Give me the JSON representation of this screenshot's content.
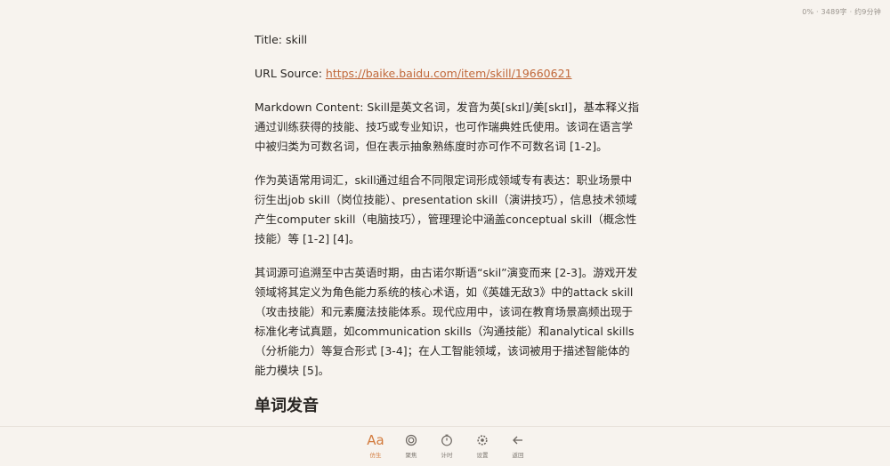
{
  "status_bar": {
    "text": "0% · 3489字 · 约9分钟"
  },
  "article": {
    "title_line": "Title: skill",
    "url_label": "URL Source: ",
    "url": "https://baike.baidu.com/item/skill/19660621",
    "paragraphs": [
      "Markdown Content: Skill是英文名词，发音为英[skɪl]/美[skɪl]，基本释义指通过训练获得的技能、技巧或专业知识，也可作瑞典姓氏使用。该词在语言学中被归类为可数名词，但在表示抽象熟练度时亦可作不可数名词 [1-2]。",
      "作为英语常用词汇，skill通过组合不同限定词形成领域专有表达：职业场景中衍生出job skill（岗位技能）、presentation skill（演讲技巧），信息技术领域产生computer skill（电脑技巧），管理理论中涵盖conceptual skill（概念性技能）等 [1-2] [4]。",
      "其词源可追溯至中古英语时期，由古诺尔斯语“skil”演变而来 [2-3]。游戏开发领域将其定义为角色能力系统的核心术语，如《英雄无敌3》中的attack skill（攻击技能）和元素魔法技能体系。现代应用中，该词在教育场景高频出现于标准化考试真题，如communication skills（沟通技能）和analytical skills（分析能力）等复合形式 [3-4]；在人工智能领域，该词被用于描述智能体的能力模块 [5]。"
    ],
    "section_heading": "单词发音"
  },
  "toolbar": {
    "items": [
      {
        "icon": "Aa",
        "label": "仿生"
      },
      {
        "icon": "focus-icon",
        "label": "聚焦"
      },
      {
        "icon": "timer-icon",
        "label": "计时"
      },
      {
        "icon": "gear-icon",
        "label": "设置"
      },
      {
        "icon": "back-arrow-icon",
        "label": "返回"
      }
    ],
    "active_color": "#d27a3c"
  }
}
